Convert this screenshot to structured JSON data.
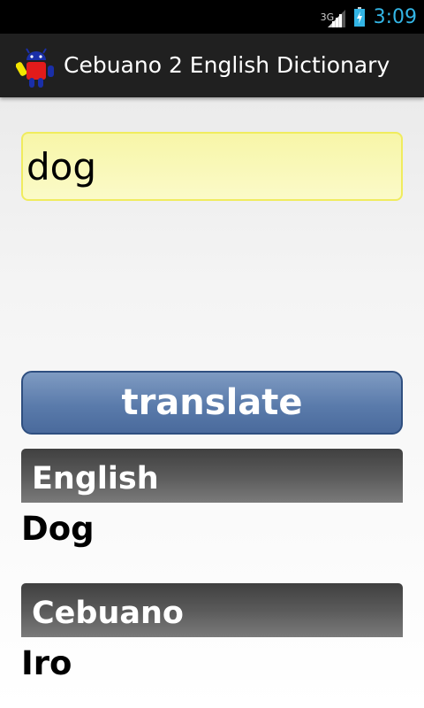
{
  "status_bar": {
    "network_type": "3G",
    "time": "3:09",
    "signal_icon": "signal-icon",
    "battery_icon": "battery-charging-icon",
    "clock_color": "#33b5e5"
  },
  "action_bar": {
    "title": "Cebuano 2 English Dictionary",
    "app_icon": "android-robot-icon"
  },
  "search": {
    "value": "dog",
    "placeholder": ""
  },
  "translate_button": {
    "label": "translate",
    "color": "#5a7bab"
  },
  "results": [
    {
      "header": "English",
      "text": "Dog"
    },
    {
      "header": "Cebuano",
      "text": "Iro"
    }
  ],
  "colors": {
    "input_background": "#f8f7b3",
    "input_border": "#f0ec5e",
    "section_header": "#505050"
  }
}
